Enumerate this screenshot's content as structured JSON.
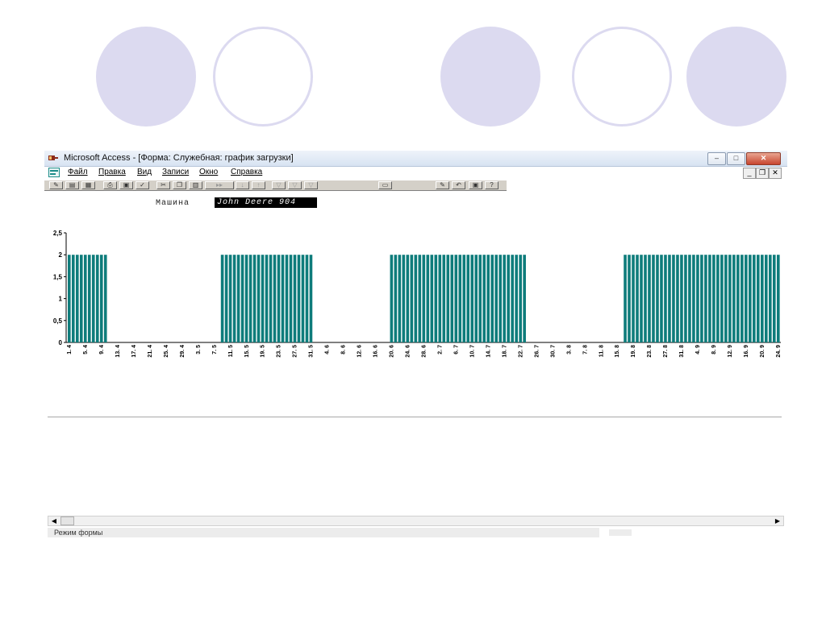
{
  "window": {
    "title": "Microsoft Access - [Форма: Служебная: график загрузки]",
    "minimize": "–",
    "maximize": "□",
    "close": "✕"
  },
  "menu": {
    "items": [
      "Файл",
      "Правка",
      "Вид",
      "Записи",
      "Окно",
      "Справка"
    ],
    "doc_minimize": "_",
    "doc_restore": "❐",
    "doc_close": "✕"
  },
  "toolbar": {
    "icons": [
      "design-view-icon",
      "form-view-icon",
      "datasheet-view-icon",
      "print-icon",
      "print-preview-icon",
      "spelling-icon",
      "cut-icon",
      "copy-icon",
      "paste-icon",
      "format-painter-icon",
      "sort-ascending-icon",
      "sort-descending-icon",
      "filter-by-selection-icon",
      "filter-by-form-icon",
      "apply-filter-icon",
      "properties-icon",
      "new-object-icon",
      "undo-icon",
      "office-assistant-icon",
      "help-icon"
    ]
  },
  "form": {
    "machine_label": "Машина",
    "machine_value": "John Deere 904"
  },
  "statusbar": {
    "mode": "Режим формы"
  },
  "colors": {
    "bar": "#0e7c7b",
    "circle_fill": "#dcdaf0"
  },
  "chart_data": {
    "type": "bar",
    "title": "",
    "xlabel": "",
    "ylabel": "",
    "ylim": [
      0,
      2.5
    ],
    "yticks": [
      "0",
      "0,5",
      "1",
      "1,5",
      "2",
      "2,5"
    ],
    "xtick_labels": [
      "1. 4",
      "5. 4",
      "9. 4",
      "13. 4",
      "17. 4",
      "21. 4",
      "25. 4",
      "29. 4",
      "3. 5",
      "7. 5",
      "11. 5",
      "15. 5",
      "19. 5",
      "23. 5",
      "27. 5",
      "31. 5",
      "4. 6",
      "8. 6",
      "12. 6",
      "16. 6",
      "20. 6",
      "24. 6",
      "28. 6",
      "2. 7",
      "6. 7",
      "10. 7",
      "14. 7",
      "18. 7",
      "22. 7",
      "26. 7",
      "30. 7",
      "3. 8",
      "7. 8",
      "11. 8",
      "15. 8",
      "19. 8",
      "23. 8",
      "27. 8",
      "31. 8",
      "4. 9",
      "8. 9",
      "12. 9",
      "16. 9",
      "20. 9",
      "24. 9"
    ],
    "days_per_tick": 4,
    "categories_count": 177,
    "active_periods": [
      [
        0,
        9
      ],
      [
        38,
        60
      ],
      [
        80,
        113
      ],
      [
        138,
        182
      ]
    ],
    "active_value": 2,
    "grid": false,
    "legend": "none"
  }
}
